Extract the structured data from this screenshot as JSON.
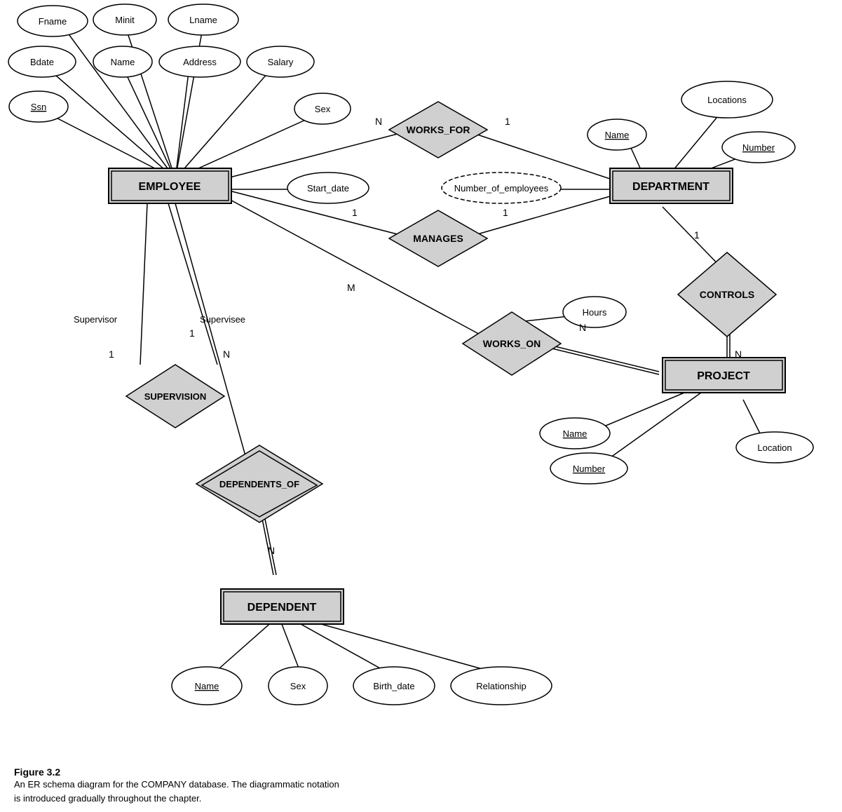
{
  "caption": {
    "title": "Figure 3.2",
    "line1": "An ER schema diagram for the COMPANY database. The diagrammatic notation",
    "line2": "is introduced gradually throughout the chapter."
  },
  "entities": {
    "employee": "EMPLOYEE",
    "department": "DEPARTMENT",
    "project": "PROJECT",
    "dependent": "DEPENDENT"
  },
  "relationships": {
    "works_for": "WORKS_FOR",
    "manages": "MANAGES",
    "works_on": "WORKS_ON",
    "controls": "CONTROLS",
    "supervision": "SUPERVISION",
    "dependents_of": "DEPENDENTS_OF"
  },
  "attributes": {
    "fname": "Fname",
    "minit": "Minit",
    "lname": "Lname",
    "bdate": "Bdate",
    "name_emp": "Name",
    "address": "Address",
    "salary": "Salary",
    "ssn": "Ssn",
    "sex_emp": "Sex",
    "start_date": "Start_date",
    "locations": "Locations",
    "dept_name": "Name",
    "dept_number": "Number",
    "num_employees": "Number_of_employees",
    "hours": "Hours",
    "proj_name": "Name",
    "proj_number": "Number",
    "proj_location": "Location",
    "dep_name": "Name",
    "dep_sex": "Sex",
    "dep_birth": "Birth_date",
    "relationship": "Relationship"
  }
}
